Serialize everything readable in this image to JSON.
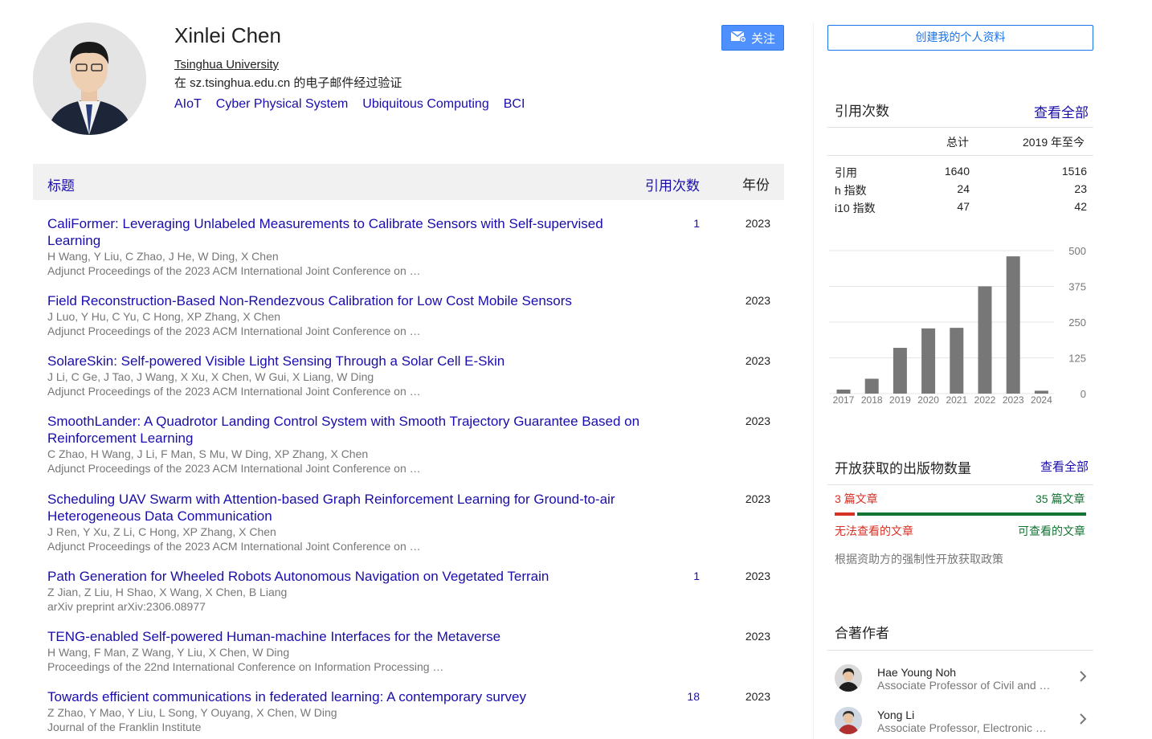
{
  "profile": {
    "name": "Xinlei Chen",
    "affiliation": "Tsinghua University",
    "email_verified": "在 sz.tsinghua.edu.cn 的电子邮件经过验证",
    "interests": [
      "AIoT",
      "Cyber Physical System",
      "Ubiquitous Computing",
      "BCI"
    ],
    "follow_label": "关注"
  },
  "table": {
    "col_title": "标题",
    "col_cites": "引用次数",
    "col_year": "年份",
    "rows": [
      {
        "title": "CaliFormer: Leveraging Unlabeled Measurements to Calibrate Sensors with Self-supervised Learning",
        "authors": "H Wang, Y Liu, C Zhao, J He, W Ding, X Chen",
        "venue": "Adjunct Proceedings of the 2023 ACM International Joint Conference on …",
        "cites": "1",
        "year": "2023"
      },
      {
        "title": "Field Reconstruction-Based Non-Rendezvous Calibration for Low Cost Mobile Sensors",
        "authors": "J Luo, Y Hu, C Yu, C Hong, XP Zhang, X Chen",
        "venue": "Adjunct Proceedings of the 2023 ACM International Joint Conference on …",
        "cites": "",
        "year": "2023"
      },
      {
        "title": "SolareSkin: Self-powered Visible Light Sensing Through a Solar Cell E-Skin",
        "authors": "J Li, C Ge, J Tao, J Wang, X Xu, X Chen, W Gui, X Liang, W Ding",
        "venue": "Adjunct Proceedings of the 2023 ACM International Joint Conference on …",
        "cites": "",
        "year": "2023"
      },
      {
        "title": "SmoothLander: A Quadrotor Landing Control System with Smooth Trajectory Guarantee Based on Reinforcement Learning",
        "authors": "C Zhao, H Wang, J Li, F Man, S Mu, W Ding, XP Zhang, X Chen",
        "venue": "Adjunct Proceedings of the 2023 ACM International Joint Conference on …",
        "cites": "",
        "year": "2023"
      },
      {
        "title": "Scheduling UAV Swarm with Attention-based Graph Reinforcement Learning for Ground-to-air Heterogeneous Data Communication",
        "authors": "J Ren, Y Xu, Z Li, C Hong, XP Zhang, X Chen",
        "venue": "Adjunct Proceedings of the 2023 ACM International Joint Conference on …",
        "cites": "",
        "year": "2023"
      },
      {
        "title": "Path Generation for Wheeled Robots Autonomous Navigation on Vegetated Terrain",
        "authors": "Z Jian, Z Liu, H Shao, X Wang, X Chen, B Liang",
        "venue": "arXiv preprint arXiv:2306.08977",
        "cites": "1",
        "year": "2023"
      },
      {
        "title": "TENG-enabled Self-powered Human-machine Interfaces for the Metaverse",
        "authors": "H Wang, F Man, Z Wang, Y Liu, X Chen, W Ding",
        "venue": "Proceedings of the 22nd International Conference on Information Processing …",
        "cites": "",
        "year": "2023"
      },
      {
        "title": "Towards efficient communications in federated learning: A contemporary survey",
        "authors": "Z Zhao, Y Mao, Y Liu, L Song, Y Ouyang, X Chen, W Ding",
        "venue": "Journal of the Franklin Institute",
        "cites": "18",
        "year": "2023"
      }
    ]
  },
  "sidebar": {
    "create_profile_label": "创建我的个人资料",
    "cited_by": {
      "title": "引用次数",
      "view_all": "查看全部",
      "col_total": "总计",
      "col_since": "2019 年至今",
      "rows": [
        {
          "label": "引用",
          "total": "1640",
          "since": "1516"
        },
        {
          "label": "h 指数",
          "total": "24",
          "since": "23"
        },
        {
          "label": "i10 指数",
          "total": "47",
          "since": "42"
        }
      ]
    },
    "open_access": {
      "title": "开放获取的出版物数量",
      "view_all": "查看全部",
      "not_available_count": "3 篇文章",
      "available_count": "35 篇文章",
      "not_available_label": "无法查看的文章",
      "available_label": "可查看的文章",
      "policy_note": "根据资助方的强制性开放获取政策",
      "not_available_fraction": 0.08,
      "colors": {
        "unavailable": "#d93025",
        "available": "#137333"
      }
    },
    "coauthors": {
      "title": "合著作者",
      "items": [
        {
          "name": "Hae Young Noh",
          "desc": "Associate Professor of Civil and …"
        },
        {
          "name": "Yong Li",
          "desc": "Associate Professor, Electronic …"
        }
      ]
    }
  },
  "chart_data": {
    "type": "bar",
    "categories": [
      "2017",
      "2018",
      "2019",
      "2020",
      "2021",
      "2022",
      "2023",
      "2024"
    ],
    "values": [
      14,
      52,
      160,
      228,
      230,
      375,
      480,
      10
    ],
    "ylim": [
      0,
      500
    ],
    "yticks": [
      "500",
      "375",
      "250",
      "125",
      "0"
    ],
    "grid": true,
    "bar_color": "#777777"
  }
}
